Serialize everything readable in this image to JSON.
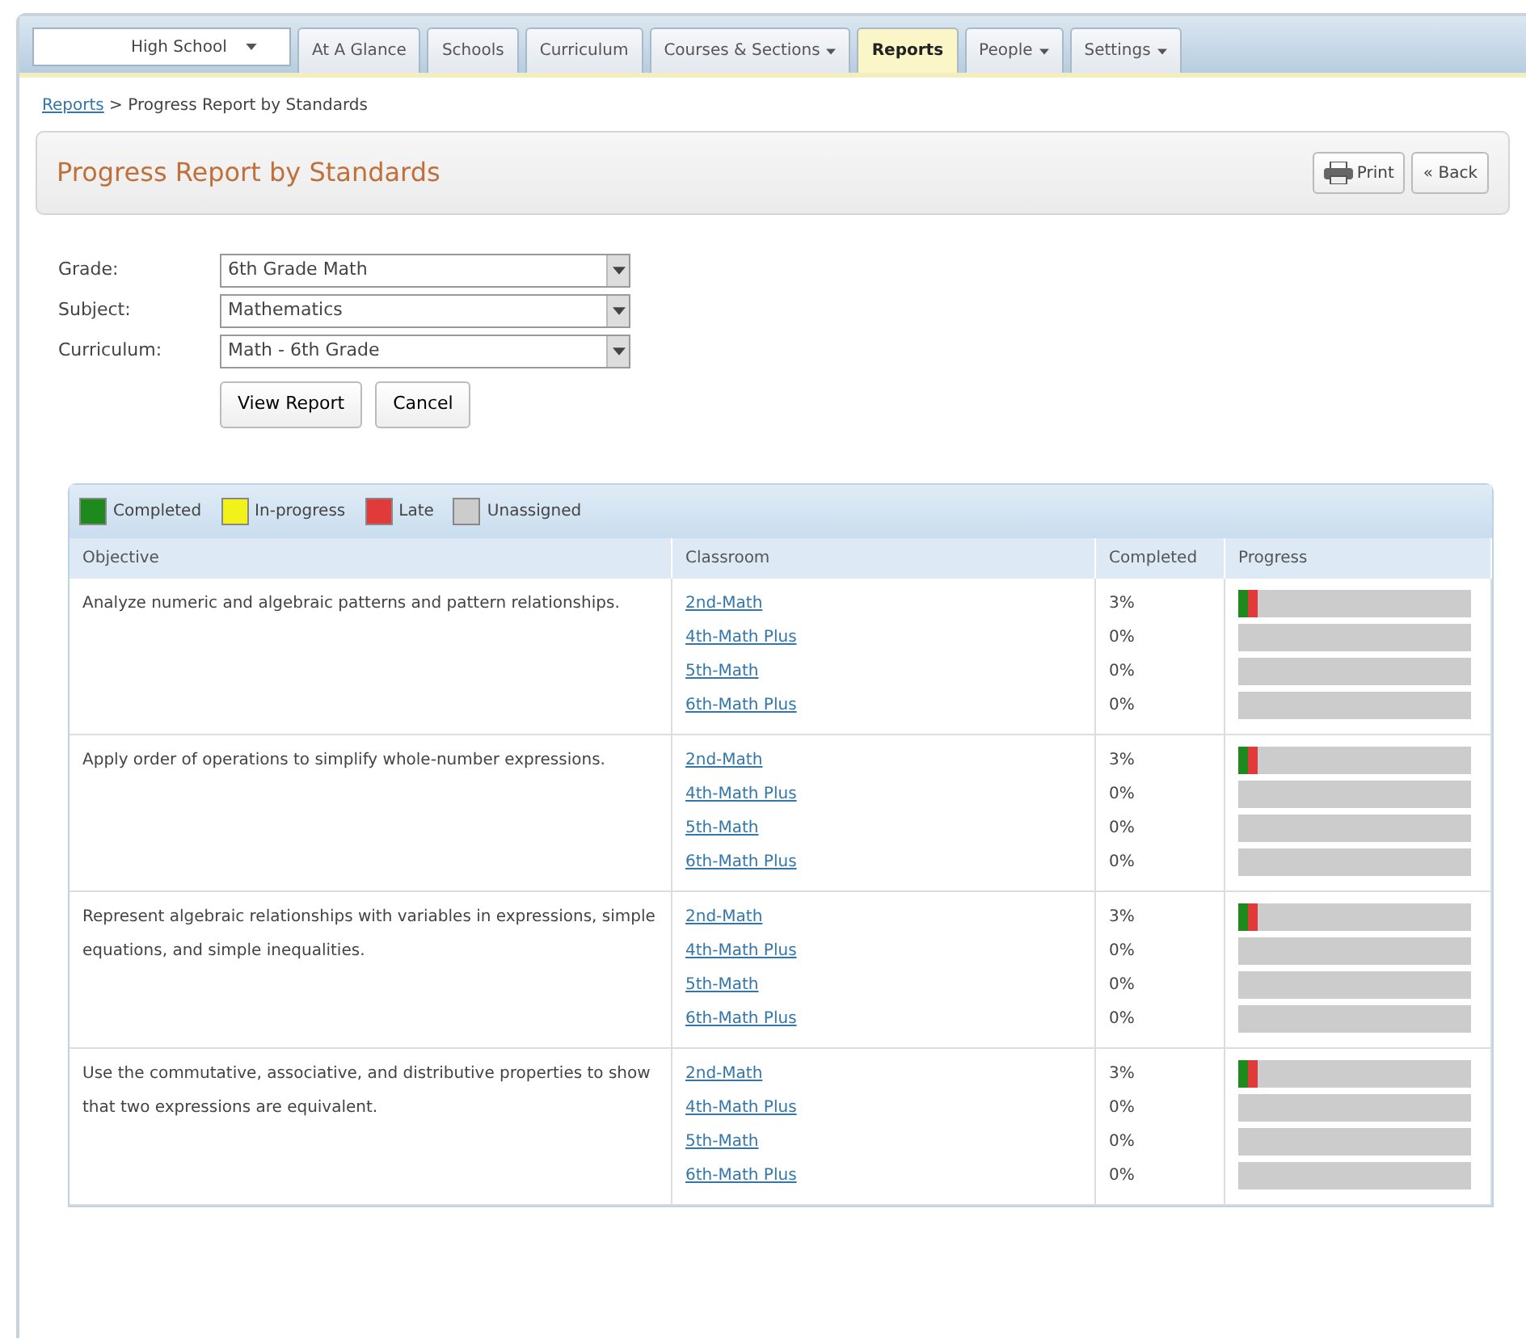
{
  "nav": {
    "school_select": {
      "value": "High School"
    },
    "tabs": [
      {
        "label": "At A Glance",
        "selected": false,
        "dropdown": false
      },
      {
        "label": "Schools",
        "selected": false,
        "dropdown": false
      },
      {
        "label": "Curriculum",
        "selected": false,
        "dropdown": false
      },
      {
        "label": "Courses & Sections",
        "selected": false,
        "dropdown": true
      },
      {
        "label": "Reports",
        "selected": true,
        "dropdown": false
      },
      {
        "label": "People",
        "selected": false,
        "dropdown": true
      },
      {
        "label": "Settings",
        "selected": false,
        "dropdown": true
      }
    ]
  },
  "breadcrumb": {
    "link": "Reports",
    "separator": ">",
    "current": "Progress Report by Standards"
  },
  "header": {
    "title": "Progress Report by Standards",
    "buttons": [
      {
        "kind": "print",
        "label": "Print"
      },
      {
        "kind": "back",
        "label": "« Back"
      }
    ]
  },
  "form": {
    "fields": [
      {
        "label": "Grade:",
        "value": "6th Grade Math"
      },
      {
        "label": "Subject:",
        "value": "Mathematics"
      },
      {
        "label": "Curriculum:",
        "value": "Math - 6th Grade"
      }
    ],
    "buttons": [
      "View Report",
      "Cancel"
    ]
  },
  "legend": [
    {
      "label": "Completed",
      "color": "#1e8a1e"
    },
    {
      "label": "In-progress",
      "color": "#f2f21a"
    },
    {
      "label": "Late",
      "color": "#e03a3a"
    },
    {
      "label": "Unassigned",
      "color": "#cccccc"
    }
  ],
  "table": {
    "columns": [
      "Objective",
      "Classroom",
      "Completed",
      "Progress"
    ],
    "rows": [
      {
        "objective": "Analyze numeric and algebraic patterns and pattern relationships.",
        "classes": [
          {
            "classroom": "2nd-Math",
            "completed": "3%",
            "segments": [
              {
                "color": "#1e8a1e",
                "level": 0.04
              },
              {
                "color": "#e03a3a",
                "level": 0.045
              }
            ]
          },
          {
            "classroom": "4th-Math Plus",
            "completed": "0%"
          },
          {
            "classroom": "5th-Math",
            "completed": "0%"
          },
          {
            "classroom": "6th-Math Plus",
            "completed": "0%"
          }
        ]
      },
      {
        "objective": "Apply order of operations to simplify whole-number expressions.",
        "classes": [
          {
            "classroom": "2nd-Math",
            "completed": "3%",
            "segments": [
              {
                "color": "#1e8a1e",
                "level": 0.04
              },
              {
                "color": "#e03a3a",
                "level": 0.045
              }
            ]
          },
          {
            "classroom": "4th-Math Plus",
            "completed": "0%"
          },
          {
            "classroom": "5th-Math",
            "completed": "0%"
          },
          {
            "classroom": "6th-Math Plus",
            "completed": "0%"
          }
        ]
      },
      {
        "objective": "Represent algebraic relationships with variables in expressions, simple equations, and simple inequalities.",
        "classes": [
          {
            "classroom": "2nd-Math",
            "completed": "3%",
            "segments": [
              {
                "color": "#1e8a1e",
                "level": 0.04
              },
              {
                "color": "#e03a3a",
                "level": 0.045
              }
            ]
          },
          {
            "classroom": "4th-Math Plus",
            "completed": "0%"
          },
          {
            "classroom": "5th-Math",
            "completed": "0%"
          },
          {
            "classroom": "6th-Math Plus",
            "completed": "0%"
          }
        ]
      },
      {
        "objective": "Use the commutative, associative, and distributive properties to show that two expressions are equivalent.",
        "classes": [
          {
            "classroom": "2nd-Math",
            "completed": "3%",
            "segments": [
              {
                "color": "#1e8a1e",
                "level": 0.04
              },
              {
                "color": "#e03a3a",
                "level": 0.045
              }
            ]
          },
          {
            "classroom": "4th-Math Plus",
            "completed": "0%"
          },
          {
            "classroom": "5th-Math",
            "completed": "0%"
          },
          {
            "classroom": "6th-Math Plus",
            "completed": "0%"
          }
        ]
      }
    ]
  }
}
